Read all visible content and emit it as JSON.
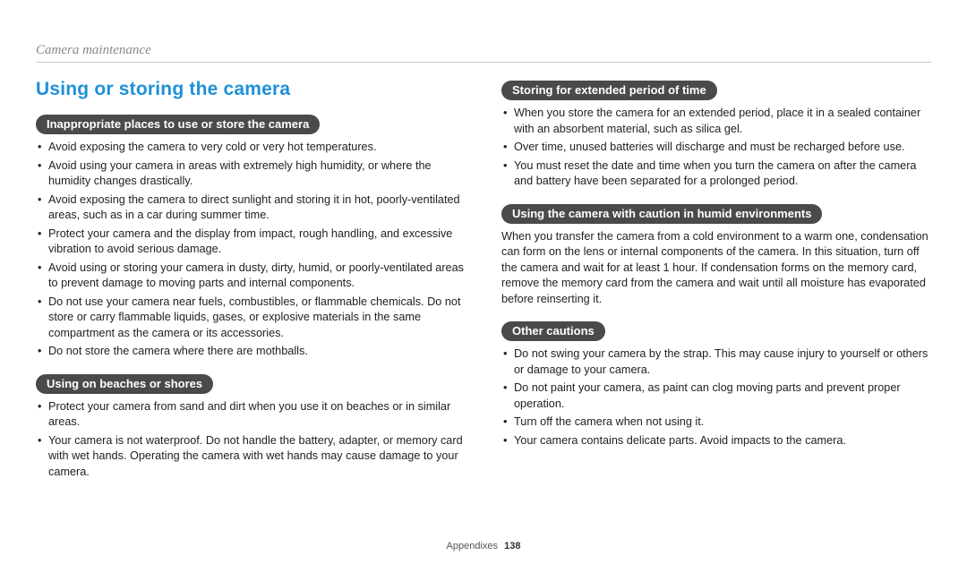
{
  "breadcrumb": "Camera maintenance",
  "section_title": "Using or storing the camera",
  "left": {
    "block1": {
      "heading": "Inappropriate places to use or store the camera",
      "items": [
        "Avoid exposing the camera to very cold or very hot temperatures.",
        "Avoid using your camera in areas with extremely high humidity, or where the humidity changes drastically.",
        "Avoid exposing the camera to direct sunlight and storing it in hot, poorly-ventilated areas, such as in a car during summer time.",
        "Protect your camera and the display from impact, rough handling, and excessive vibration to avoid serious damage.",
        "Avoid using or storing your camera in dusty, dirty, humid, or poorly-ventilated areas to prevent damage to moving parts and internal components.",
        "Do not use your camera near fuels, combustibles, or flammable chemicals. Do not store or carry flammable liquids, gases, or explosive materials in the same compartment as the camera or its accessories.",
        "Do not store the camera where there are mothballs."
      ]
    },
    "block2": {
      "heading": "Using on beaches or shores",
      "items": [
        "Protect your camera from sand and dirt when you use it on beaches or in similar areas.",
        "Your camera is not waterproof. Do not handle the battery, adapter, or memory card with wet hands. Operating the camera with wet hands may cause damage to your camera."
      ]
    }
  },
  "right": {
    "block1": {
      "heading": "Storing for extended period of time",
      "items": [
        "When you store the camera for an extended period, place it in a sealed container with an absorbent material, such as silica gel.",
        "Over time, unused batteries will discharge and must be recharged before use.",
        "You must reset the date and time when you turn the camera on after the camera and battery have been separated for a prolonged period."
      ]
    },
    "block2": {
      "heading": "Using the camera with caution in humid environments",
      "paragraph": "When you transfer the camera from a cold environment to a warm one, condensation can form on the lens or internal components of the camera. In this situation, turn off the camera and wait for at least 1 hour. If condensation forms on the memory card, remove the memory card from the camera and wait until all moisture has evaporated before reinserting it."
    },
    "block3": {
      "heading": "Other cautions",
      "items": [
        "Do not swing your camera by the strap. This may cause injury to yourself or others or damage to your camera.",
        "Do not paint your camera, as paint can clog moving parts and prevent proper operation.",
        "Turn off the camera when not using it.",
        "Your camera contains delicate parts. Avoid impacts to the camera."
      ]
    }
  },
  "footer": {
    "label": "Appendixes",
    "page": "138"
  }
}
